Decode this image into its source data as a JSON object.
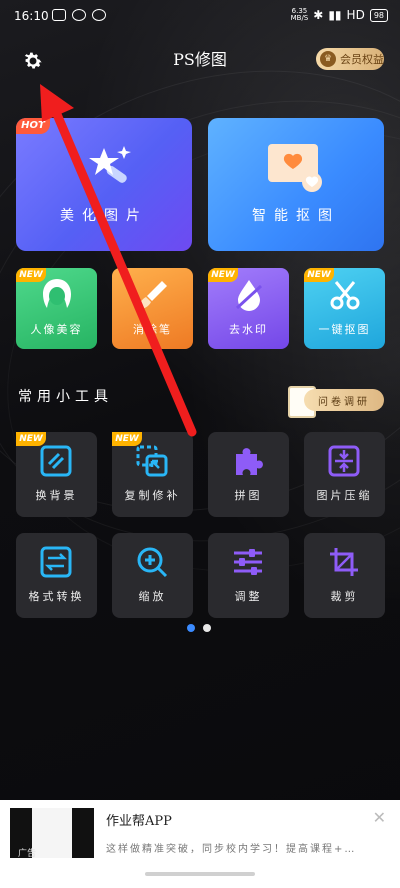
{
  "status_bar": {
    "time": "16:10",
    "net_speed_value": "6.35",
    "net_speed_unit": "MB/S",
    "network": "HD",
    "battery": "98"
  },
  "header": {
    "title": "PS修图",
    "vip_label": "会员权益"
  },
  "big_cards": [
    {
      "label": "美化图片",
      "badge": "HOT",
      "color": "#6a62f7"
    },
    {
      "label": "智能抠图",
      "color": "#3b8cff"
    }
  ],
  "small_cards": [
    {
      "label": "人像美容",
      "badge": "NEW",
      "color": "#2fbf71"
    },
    {
      "label": "消除笔",
      "color": "#f28a2e"
    },
    {
      "label": "去水印",
      "badge": "NEW",
      "color": "#8a63f2"
    },
    {
      "label": "一键抠图",
      "badge": "NEW",
      "color": "#2bb7e8"
    }
  ],
  "tools_section": {
    "title": "常用小工具",
    "survey_label": "问卷调研"
  },
  "tools": [
    {
      "label": "换背景",
      "badge": "NEW",
      "icon": "background-swap-icon"
    },
    {
      "label": "复制修补",
      "badge": "NEW",
      "icon": "copy-patch-icon"
    },
    {
      "label": "拼图",
      "icon": "puzzle-icon"
    },
    {
      "label": "图片压缩",
      "icon": "compress-icon"
    },
    {
      "label": "格式转换",
      "icon": "format-convert-icon"
    },
    {
      "label": "缩放",
      "icon": "zoom-icon"
    },
    {
      "label": "调整",
      "icon": "adjust-sliders-icon"
    },
    {
      "label": "裁剪",
      "icon": "crop-icon"
    }
  ],
  "pager": {
    "pages": 2,
    "current": 1
  },
  "ad": {
    "app_name": "作业帮APP",
    "description": "这样做精准突破，同步校内学习！提高课程+…",
    "tag": "广告"
  },
  "colors": {
    "accent_blue": "#3b8bff",
    "annotation_red": "#f01e1e"
  }
}
